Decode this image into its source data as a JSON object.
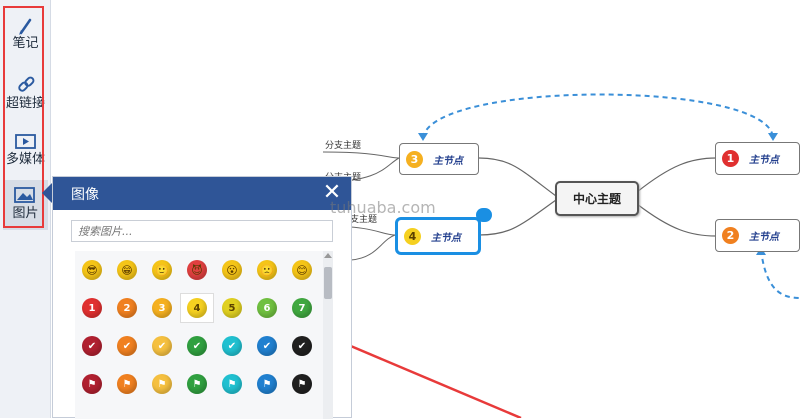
{
  "sidebar": {
    "items": [
      {
        "label": "笔记",
        "icon": "pen-icon"
      },
      {
        "label": "超链接",
        "icon": "link-icon"
      },
      {
        "label": "多媒体",
        "icon": "video-icon"
      },
      {
        "label": "图片",
        "icon": "image-icon"
      }
    ]
  },
  "panel": {
    "title": "图像",
    "close": "✕",
    "search_placeholder": "搜索图片..."
  },
  "icon_rows": [
    [
      {
        "t": "face",
        "c": "#f5c518",
        "g": "😎"
      },
      {
        "t": "face",
        "c": "#f5c518",
        "g": "😁"
      },
      {
        "t": "face",
        "c": "#f5c518",
        "g": "🙂"
      },
      {
        "t": "face",
        "c": "#e04040",
        "g": "😈"
      },
      {
        "t": "face",
        "c": "#f5c518",
        "g": "😮"
      },
      {
        "t": "face",
        "c": "#f5c518",
        "g": "🙁"
      },
      {
        "t": "face",
        "c": "#f5c518",
        "g": "😊"
      }
    ],
    [
      {
        "t": "num",
        "c": "#e03030",
        "g": "1"
      },
      {
        "t": "num",
        "c": "#f08020",
        "g": "2"
      },
      {
        "t": "num",
        "c": "#f5b020",
        "g": "3"
      },
      {
        "t": "num",
        "c": "#f5d020",
        "g": "4",
        "hl": true
      },
      {
        "t": "num",
        "c": "#e0d020",
        "g": "5"
      },
      {
        "t": "num",
        "c": "#70c040",
        "g": "6"
      },
      {
        "t": "num",
        "c": "#40a840",
        "g": "7"
      }
    ],
    [
      {
        "t": "check",
        "c": "#b02030",
        "g": "✔"
      },
      {
        "t": "check",
        "c": "#f08020",
        "g": "✔"
      },
      {
        "t": "check",
        "c": "#f5c040",
        "g": "✔"
      },
      {
        "t": "check",
        "c": "#30a040",
        "g": "✔"
      },
      {
        "t": "check",
        "c": "#20c0d0",
        "g": "✔"
      },
      {
        "t": "check",
        "c": "#2080d0",
        "g": "✔"
      },
      {
        "t": "check",
        "c": "#202020",
        "g": "✔"
      }
    ],
    [
      {
        "t": "flag",
        "c": "#b02030",
        "g": "⚑"
      },
      {
        "t": "flag",
        "c": "#f08020",
        "g": "⚑"
      },
      {
        "t": "flag",
        "c": "#f5c040",
        "g": "⚑"
      },
      {
        "t": "flag",
        "c": "#30a040",
        "g": "⚑"
      },
      {
        "t": "flag",
        "c": "#20c0d0",
        "g": "⚑"
      },
      {
        "t": "flag",
        "c": "#2080d0",
        "g": "⚑"
      },
      {
        "t": "flag",
        "c": "#202020",
        "g": "⚑"
      }
    ]
  ],
  "mindmap": {
    "center": "中心主题",
    "branch_label": "主节点",
    "sub_label": "分支主题",
    "nodes": [
      {
        "num": "3",
        "color": "#f5b020"
      },
      {
        "num": "4",
        "color": "#f5d020"
      },
      {
        "num": "1",
        "color": "#e03030"
      },
      {
        "num": "2",
        "color": "#f08020"
      }
    ]
  },
  "colors": {
    "accent": "#2f5597",
    "selection": "#1a8fe3",
    "annotation": "#e83a3a",
    "dashed_link": "#3a8fd8"
  },
  "watermark": "tuhuaba.com"
}
